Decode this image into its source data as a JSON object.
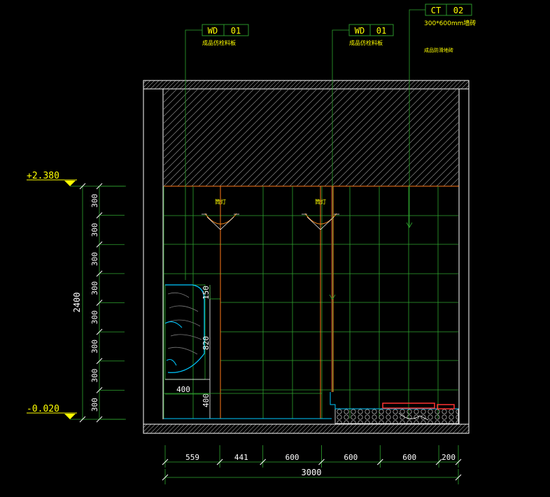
{
  "tags": [
    {
      "code": "WD",
      "num": "01",
      "note": "成品仿栓料板"
    },
    {
      "code": "WD",
      "num": "01",
      "note": "成品仿栓料板"
    },
    {
      "code": "CT",
      "num": "02",
      "note": "300*600mm墙砖",
      "note2": "成品防滑地砖"
    }
  ],
  "levels": {
    "top": "+2.380",
    "bottom": "-0.020"
  },
  "left_dims": {
    "rows": [
      "300",
      "300",
      "300",
      "300",
      "300",
      "300",
      "300",
      "300"
    ],
    "total": "2400"
  },
  "inner_dims": {
    "cabinet_height": "820",
    "cabinet_gap": "150",
    "cabinet_width": "400",
    "base_height": "400"
  },
  "bottom_dims": {
    "segments": [
      "559",
      "441",
      "600",
      "600",
      "600",
      "200"
    ],
    "total": "3000"
  },
  "fixtures": {
    "left": "筒灯",
    "right": "筒灯"
  },
  "colors": {
    "line_green": "#39c039",
    "line_white": "#ffffff",
    "text_yellow": "#ffff00",
    "accent_red": "#ff3333",
    "accent_cyan": "#00c8ff",
    "accent_orange": "#ff8c1a"
  }
}
